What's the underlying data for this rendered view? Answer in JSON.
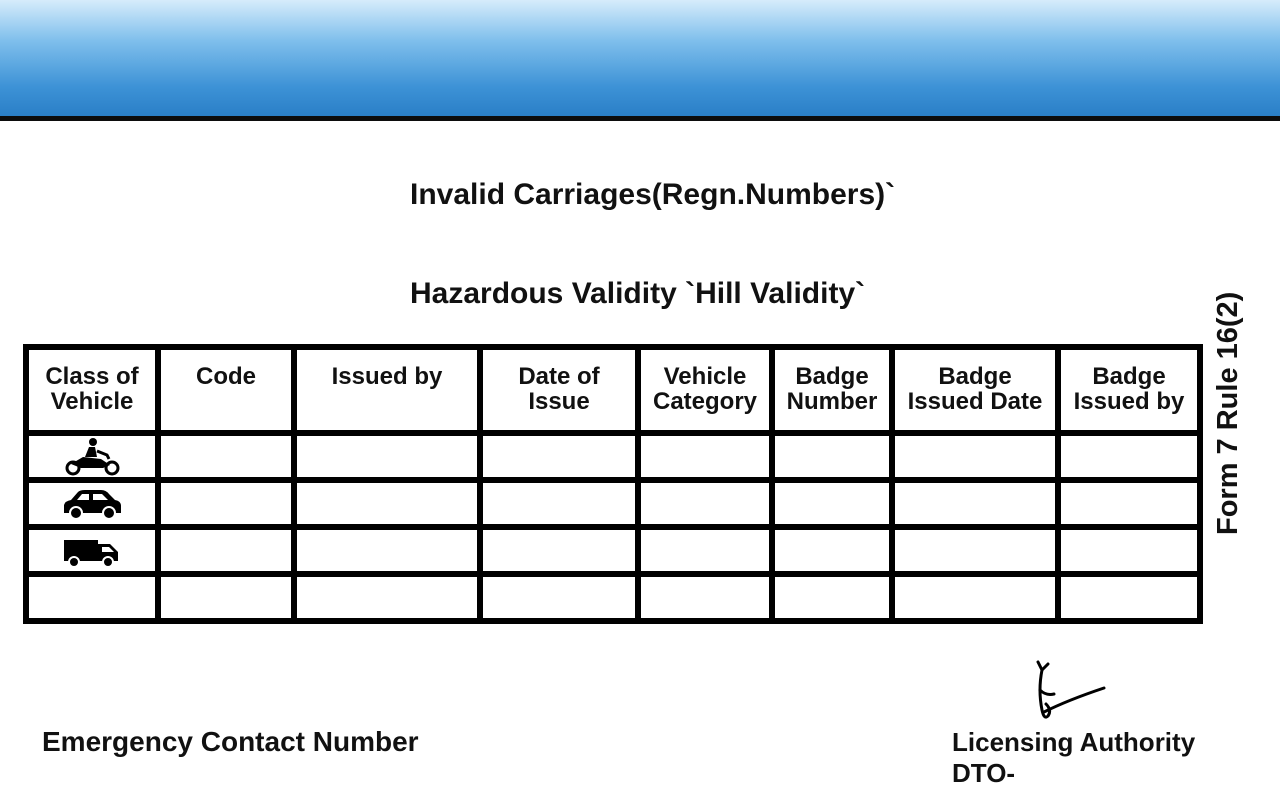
{
  "headings": {
    "line1": "Invalid Carriages(Regn.Numbers)`",
    "line2": "Hazardous Validity `Hill Validity`"
  },
  "table": {
    "columns": [
      "Class of\nVehicle",
      "Code",
      "Issued by",
      "Date of\nIssue",
      "Vehicle\nCategory",
      "Badge\nNumber",
      "Badge\nIssued Date",
      "Badge\nIssued by"
    ],
    "rows": [
      {
        "icon": "motorcycle-icon",
        "cells": [
          "",
          "",
          "",
          "",
          "",
          "",
          ""
        ]
      },
      {
        "icon": "car-icon",
        "cells": [
          "",
          "",
          "",
          "",
          "",
          "",
          ""
        ]
      },
      {
        "icon": "truck-icon",
        "cells": [
          "",
          "",
          "",
          "",
          "",
          "",
          ""
        ]
      },
      {
        "icon": "",
        "cells": [
          "",
          "",
          "",
          "",
          "",
          "",
          ""
        ]
      }
    ]
  },
  "side_label": "Form 7 Rule 16(2)",
  "footer": {
    "emergency_label": "Emergency Contact Number",
    "authority_title": "Licensing Authority",
    "authority_office": "DTO-"
  },
  "colors": {
    "banner_top": "#d6ecfb",
    "banner_bottom": "#2a7fc7",
    "rule": "#000000"
  }
}
